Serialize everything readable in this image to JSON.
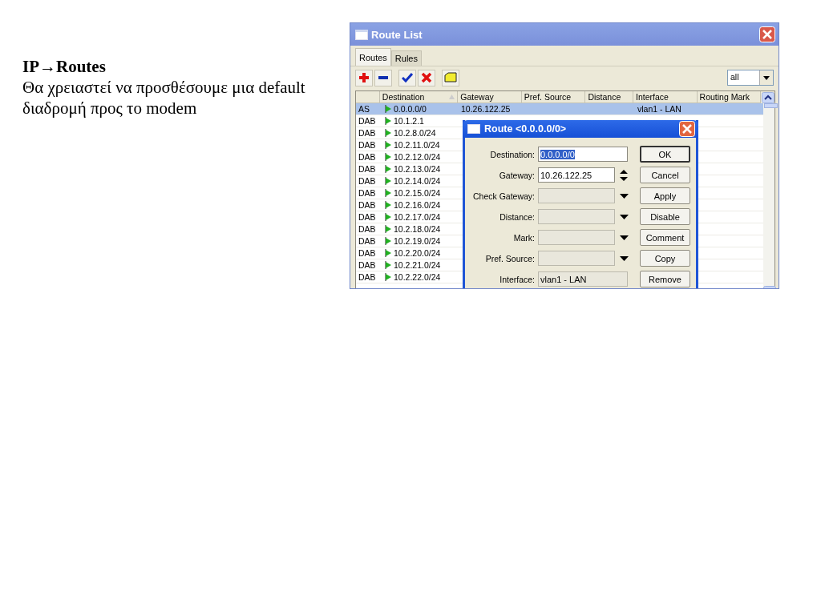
{
  "slide": {
    "heading": "IP→Routes",
    "body": "Θα χρειαστεί να προσθέσουμε μια default διαδρομή προς το modem"
  },
  "window": {
    "title": "Route List",
    "tabs": [
      {
        "label": "Routes",
        "selected": true
      },
      {
        "label": "Rules",
        "selected": false
      }
    ],
    "toolbar": [
      {
        "kind": "add"
      },
      {
        "kind": "remove"
      },
      {
        "kind": "enable"
      },
      {
        "kind": "disable"
      },
      {
        "kind": "comment"
      }
    ],
    "filter": {
      "value": "all"
    },
    "table": {
      "columns": [
        {
          "label": "Destination",
          "sorted": true
        },
        {
          "label": "Gateway",
          "sorted": false
        },
        {
          "label": "Pref. Source",
          "sorted": false
        },
        {
          "label": "Distance",
          "sorted": false
        },
        {
          "label": "Interface",
          "sorted": false
        },
        {
          "label": "Routing Mark",
          "sorted": false
        }
      ],
      "rows": [
        {
          "flags": "AS",
          "destination": "0.0.0.0/0",
          "gateway": "10.26.122.25",
          "interface": "vlan1 - LAN",
          "selected": true
        },
        {
          "flags": "DAB",
          "destination": "10.1.2.1",
          "selected": false
        },
        {
          "flags": "DAB",
          "destination": "10.2.8.0/24",
          "selected": false
        },
        {
          "flags": "DAB",
          "destination": "10.2.11.0/24",
          "selected": false
        },
        {
          "flags": "DAB",
          "destination": "10.2.12.0/24",
          "selected": false
        },
        {
          "flags": "DAB",
          "destination": "10.2.13.0/24",
          "selected": false
        },
        {
          "flags": "DAB",
          "destination": "10.2.14.0/24",
          "selected": false
        },
        {
          "flags": "DAB",
          "destination": "10.2.15.0/24",
          "selected": false
        },
        {
          "flags": "DAB",
          "destination": "10.2.16.0/24",
          "selected": false
        },
        {
          "flags": "DAB",
          "destination": "10.2.17.0/24",
          "selected": false
        },
        {
          "flags": "DAB",
          "destination": "10.2.18.0/24",
          "selected": false
        },
        {
          "flags": "DAB",
          "destination": "10.2.19.0/24",
          "selected": false
        },
        {
          "flags": "DAB",
          "destination": "10.2.20.0/24",
          "selected": false
        },
        {
          "flags": "DAB",
          "destination": "10.2.21.0/24",
          "selected": false
        },
        {
          "flags": "DAB",
          "destination": "10.2.22.0/24",
          "selected": false
        }
      ]
    }
  },
  "dialog": {
    "title": "Route <0.0.0.0/0>",
    "fields": [
      {
        "label": "Destination:",
        "kind": "text",
        "value": "0.0.0.0/0",
        "text_selected": true
      },
      {
        "label": "Gateway:",
        "kind": "spin",
        "value": "10.26.122.25",
        "text_selected": false
      },
      {
        "label": "Check Gateway:",
        "kind": "dropdown"
      },
      {
        "label": "Distance:",
        "kind": "dropdown"
      },
      {
        "label": "Mark:",
        "kind": "dropdown"
      },
      {
        "label": "Pref. Source:",
        "kind": "dropdown"
      },
      {
        "label": "Interface:",
        "kind": "readonly",
        "value": "vlan1 - LAN"
      }
    ],
    "buttons": [
      {
        "label": "OK",
        "default": true
      },
      {
        "label": "Cancel",
        "default": false
      },
      {
        "label": "Apply",
        "default": false
      },
      {
        "label": "Disable",
        "default": false
      },
      {
        "label": "Comment",
        "default": false
      },
      {
        "label": "Copy",
        "default": false
      },
      {
        "label": "Remove",
        "default": false
      }
    ]
  }
}
